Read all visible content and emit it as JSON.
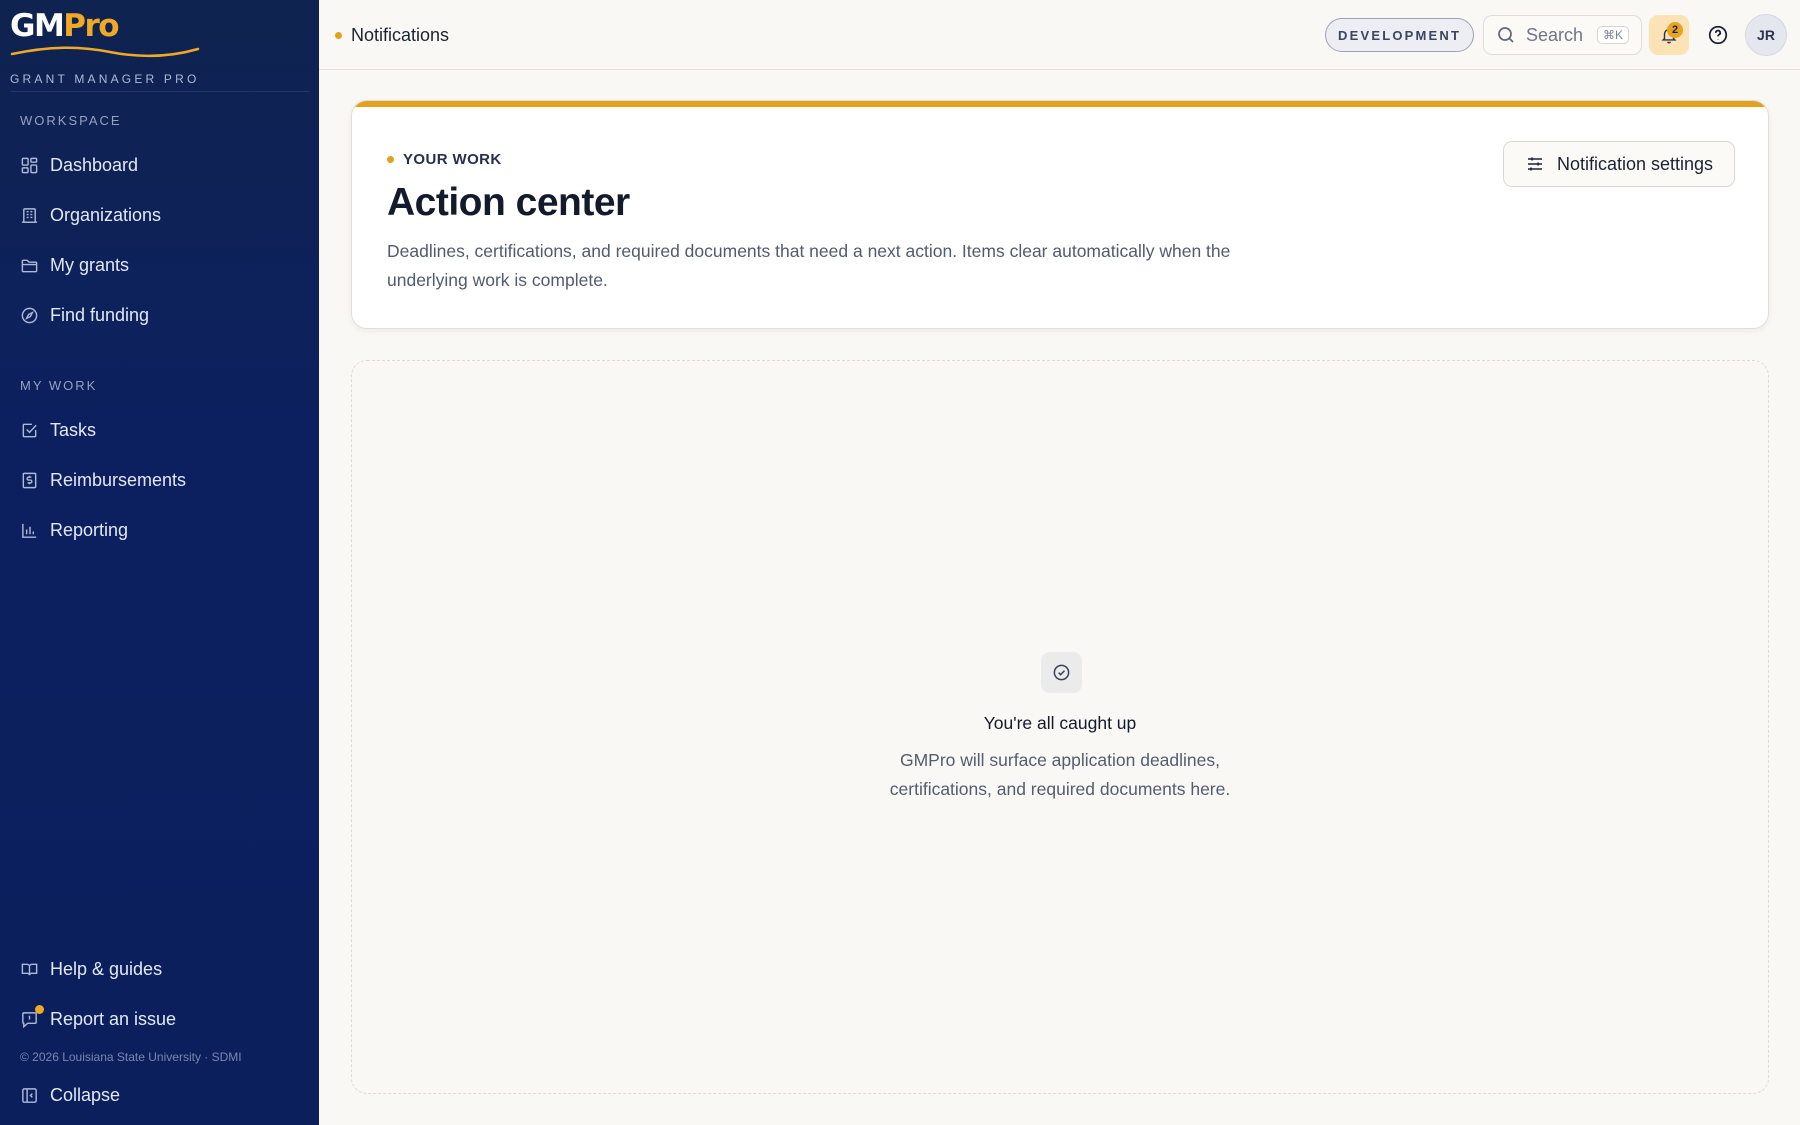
{
  "brand": {
    "logo_gm": "GM",
    "logo_pro": "Pro",
    "tagline": "GRANT MANAGER PRO"
  },
  "sidebar": {
    "workspace_label": "WORKSPACE",
    "workspace_items": [
      {
        "label": "Dashboard",
        "icon": "dashboard-icon"
      },
      {
        "label": "Organizations",
        "icon": "building-icon"
      },
      {
        "label": "My grants",
        "icon": "folder-icon"
      },
      {
        "label": "Find funding",
        "icon": "compass-icon"
      }
    ],
    "mywork_label": "MY WORK",
    "mywork_items": [
      {
        "label": "Tasks",
        "icon": "checkbox-icon"
      },
      {
        "label": "Reimbursements",
        "icon": "receipt-icon"
      },
      {
        "label": "Reporting",
        "icon": "bar-chart-icon"
      }
    ],
    "help_label": "Help & guides",
    "report_label": "Report an issue",
    "copyright": "© 2026 Louisiana State University · SDMI",
    "collapse_label": "Collapse"
  },
  "topbar": {
    "breadcrumb": "Notifications",
    "environment": "DEVELOPMENT",
    "search_placeholder": "Search",
    "search_shortcut": "⌘K",
    "notification_count": "2",
    "user_initials": "JR"
  },
  "header": {
    "eyebrow": "YOUR WORK",
    "title": "Action center",
    "description": "Deadlines, certifications, and required documents that need a next action. Items clear automatically when the underlying work is complete.",
    "settings_button": "Notification settings"
  },
  "empty_state": {
    "title": "You're all caught up",
    "line1": "GMPro will surface application deadlines,",
    "line2": "certifications, and required documents here."
  },
  "colors": {
    "sidebar_bg": "#0c2060",
    "accent": "#e3a11d",
    "page_bg": "#faf8f4"
  }
}
